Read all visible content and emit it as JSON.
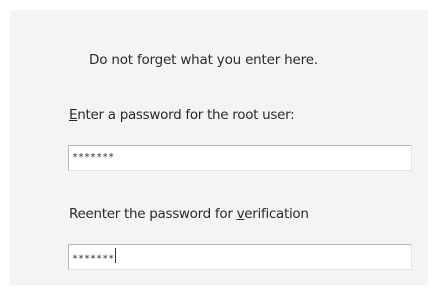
{
  "dialog": {
    "notice": "Do not forget what you enter here.",
    "password": {
      "label_mnemonic": "E",
      "label_rest": "nter a password for the root user:",
      "value": "*******"
    },
    "verify": {
      "label_before": "Reenter the password for ",
      "label_mnemonic": "v",
      "label_after": "erification",
      "value": "*******"
    }
  }
}
